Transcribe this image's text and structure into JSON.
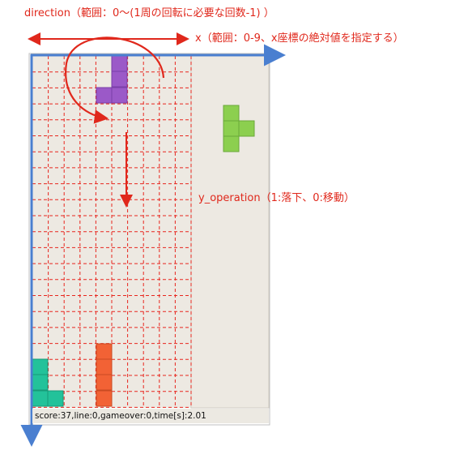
{
  "annotations": {
    "direction": "direction（範囲：0〜(1周の回転に必要な回数-1) ）",
    "x": "x（範囲：0-9、x座標の絶対値を指定する）",
    "y_operation": "y_operation（1:落下、0:移動）"
  },
  "status_bar": {
    "text": "score:37,line:0,gameover:0,time[s]:2.01"
  },
  "colors": {
    "grid_line": "#e8261e",
    "board_bg": "#ede9e2",
    "annotation": "#e0281c",
    "axis": "#4a7fd0",
    "purple": "#9b59c8",
    "green_next": "#8ccf4f",
    "teal": "#23c29a",
    "orange": "#f26235"
  }
}
